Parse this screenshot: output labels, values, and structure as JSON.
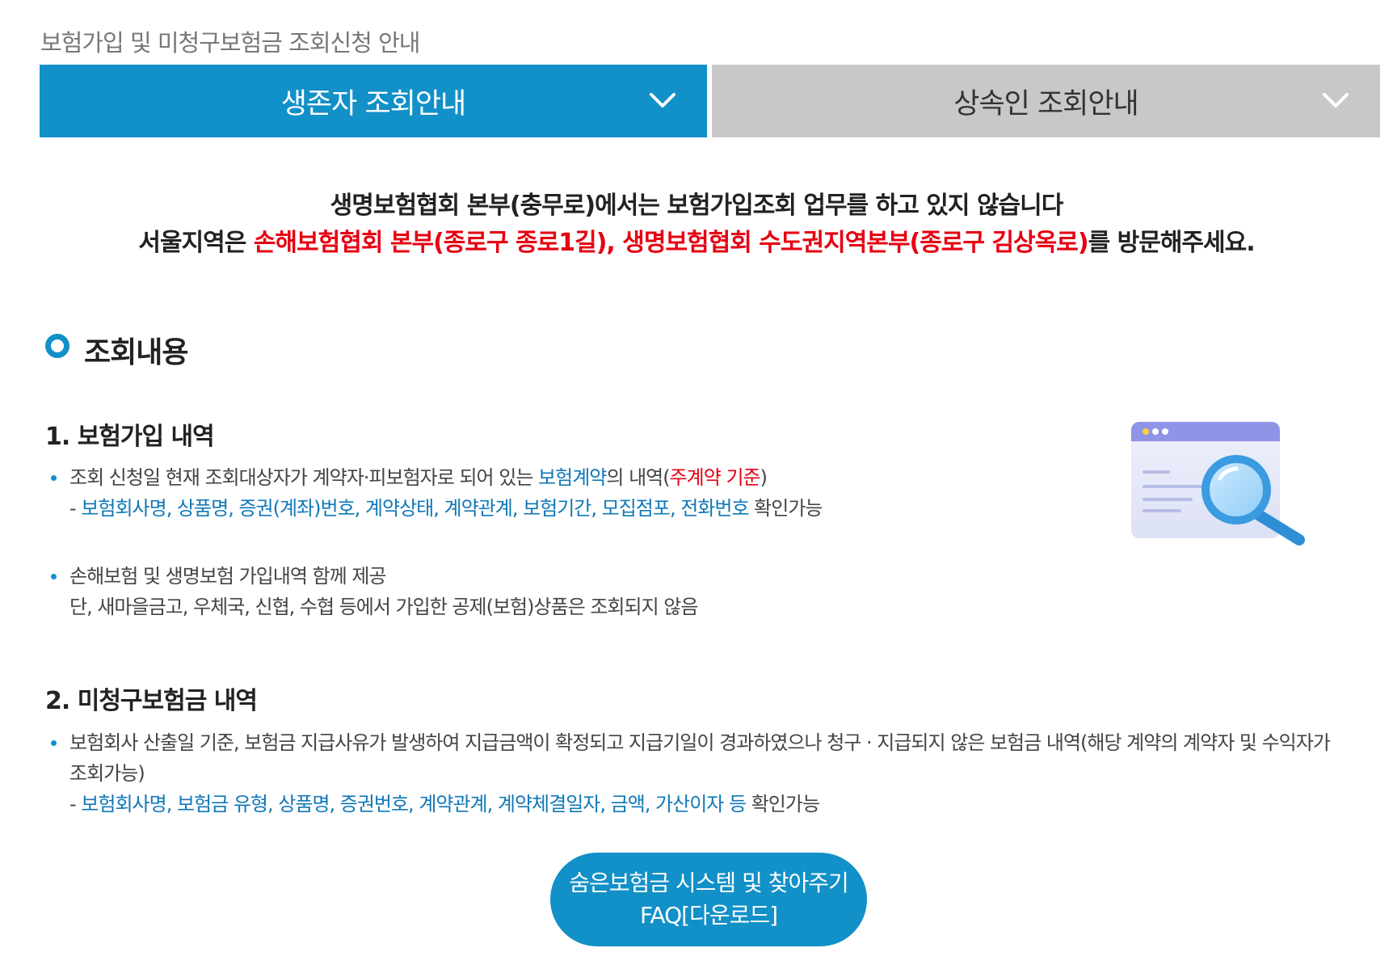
{
  "breadcrumb": "보험가입 및 미청구보험금 조회신청 안내",
  "tabs": [
    {
      "label": "생존자 조회안내",
      "active": true
    },
    {
      "label": "상속인 조회안내",
      "active": false
    }
  ],
  "notice": {
    "line1": "생명보험협회 본부(충무로)에서는 보험가입조회 업무를 하고 있지 않습니다",
    "line2_pre": "서울지역은 ",
    "line2_red": "손해보험협회 본부(종로구 종로1길), 생명보험협회 수도권지역본부(종로구 김상옥로)",
    "line2_post": "를 방문해주세요."
  },
  "section": {
    "title": "조회내용",
    "items": [
      {
        "heading": "1. 보험가입 내역",
        "bullets": [
          {
            "pre": "조회 신청일 현재 조회대상자가 계약자·피보험자로 되어 있는 ",
            "blue": "보험계약",
            "mid": "의 내역(",
            "red": "주계약 기준",
            "post": ")",
            "sub_prefix": "- ",
            "sub_blue": "보험회사명, 상품명, 증권(계좌)번호, 계약상태, 계약관계, 보험기간, 모집점포, 전화번호",
            "sub_post": " 확인가능"
          },
          {
            "line1": "손해보험 및 생명보험 가입내역 함께 제공",
            "line2": "단, 새마을금고, 우체국, 신협, 수협 등에서 가입한 공제(보험)상품은 조회되지 않음"
          }
        ]
      },
      {
        "heading": "2. 미청구보험금 내역",
        "bullets": [
          {
            "line1": "보험회사 산출일 기준, 보험금 지급사유가 발생하여 지급금액이 확정되고 지급기일이 경과하였으나 청구 · 지급되지 않은 보험금 내역(해당 계약의 계약자 및 수익자가",
            "line2": "조회가능)",
            "sub_prefix": "- ",
            "sub_blue": "보험회사명, 보험금 유형, 상품명, 증권번호, 계약관계, 계약체결일자, 금액, 가산이자 등",
            "sub_post": " 확인가능"
          }
        ]
      }
    ]
  },
  "faq_button": {
    "line1": "숨은보험금 시스템 및 찾아주기",
    "line2": "FAQ[다운로드]"
  },
  "colors": {
    "primary": "#1290c8",
    "inactive_tab": "#c8c8c8",
    "highlight_red": "#e60012",
    "link_blue": "#1078b8"
  },
  "icons": [
    "chevron-down-icon",
    "ring-bullet-icon",
    "search-window-illustration"
  ]
}
